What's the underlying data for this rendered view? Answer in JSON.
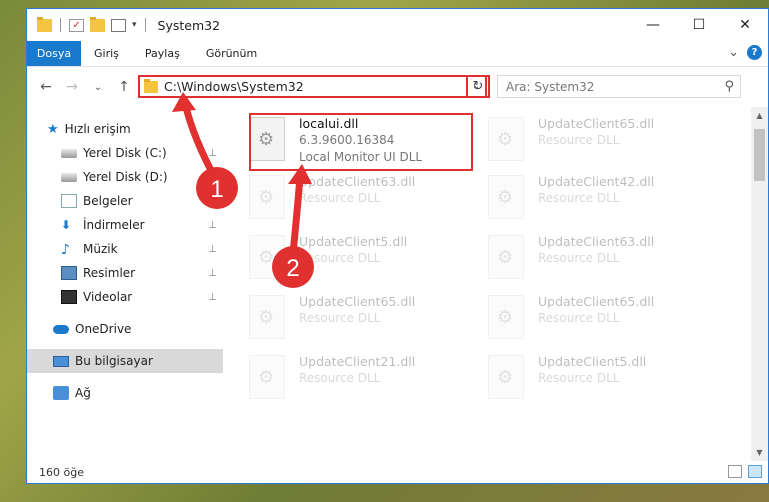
{
  "window": {
    "title": "System32",
    "controls": {
      "minimize": "—",
      "maximize": "☐",
      "close": "✕"
    }
  },
  "ribbon": {
    "tabs": [
      "Dosya",
      "Giriş",
      "Paylaş",
      "Görünüm"
    ],
    "expand_glyph": "⌄",
    "help_glyph": "?"
  },
  "nav": {
    "back": "←",
    "forward": "→",
    "recent": "⌄",
    "up": "↑",
    "address": "C:\\Windows\\System32",
    "address_dropdown": "⌄",
    "refresh": "↻",
    "search_placeholder": "Ara: System32",
    "search_glyph": "⚲"
  },
  "sidebar": {
    "items": [
      {
        "label": "Hızlı erişim",
        "icon": "star-icon"
      },
      {
        "label": "Yerel Disk (C:)",
        "icon": "drive-icon",
        "pinned": true
      },
      {
        "label": "Yerel Disk (D:)",
        "icon": "drive-icon"
      },
      {
        "label": "Belgeler",
        "icon": "documents-icon"
      },
      {
        "label": "İndirmeler",
        "icon": "downloads-icon",
        "pinned": true
      },
      {
        "label": "Müzik",
        "icon": "music-icon",
        "pinned": true
      },
      {
        "label": "Resimler",
        "icon": "pictures-icon",
        "pinned": true
      },
      {
        "label": "Videolar",
        "icon": "videos-icon",
        "pinned": true
      },
      {
        "label": "OneDrive",
        "icon": "onedrive-icon"
      },
      {
        "label": "Bu bilgisayar",
        "icon": "this-pc-icon",
        "selected": true
      },
      {
        "label": "Ağ",
        "icon": "network-icon"
      }
    ],
    "pin_glyph": "📌"
  },
  "files": [
    {
      "name": "localui.dll",
      "version": "6.3.9600.16384",
      "description": "Local Monitor UI DLL",
      "highlighted": true
    },
    {
      "name": "UpdateClient65.dll",
      "description": "Resource DLL"
    },
    {
      "name": "UpdateClient63.dll",
      "description": "Resource DLL"
    },
    {
      "name": "UpdateClient42.dll",
      "description": "Resource DLL"
    },
    {
      "name": "UpdateClient5.dll",
      "description": "Resource DLL"
    },
    {
      "name": "UpdateClient63.dll",
      "description": "Resource DLL"
    },
    {
      "name": "UpdateClient65.dll",
      "description": "Resource DLL"
    },
    {
      "name": "UpdateClient65.dll",
      "description": "Resource DLL"
    },
    {
      "name": "UpdateClient21.dll",
      "description": "Resource DLL"
    },
    {
      "name": "UpdateClient5.dll",
      "description": "Resource DLL"
    }
  ],
  "status": {
    "count": "160 öğe"
  },
  "annotations": {
    "step1": "1",
    "step2": "2",
    "color": "#e03030"
  }
}
